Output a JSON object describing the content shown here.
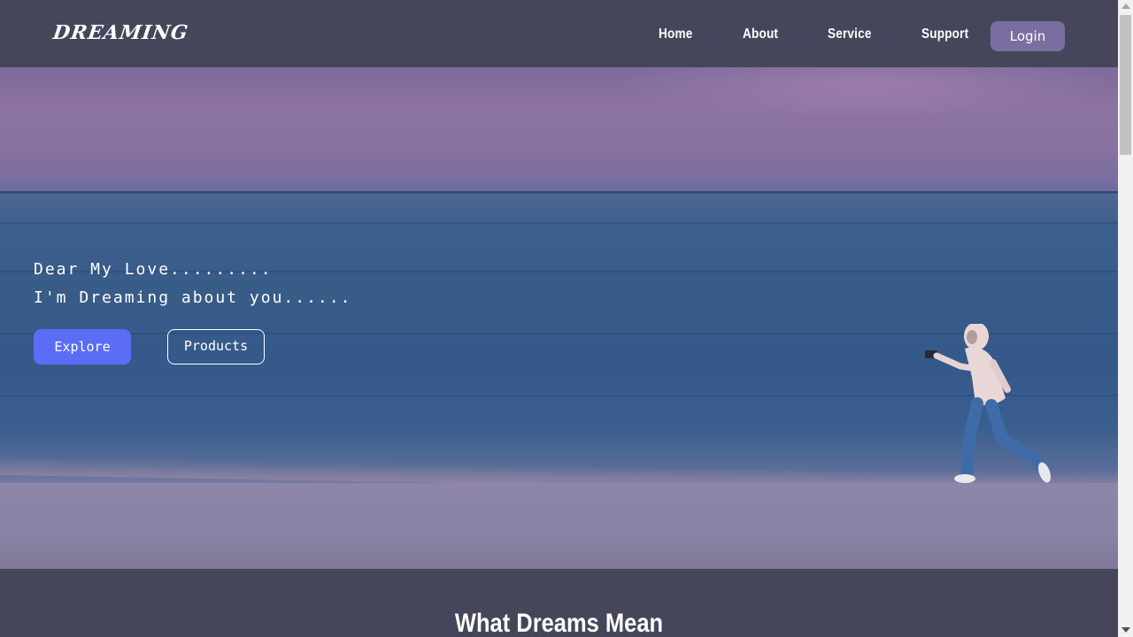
{
  "header": {
    "logo": "DREAMING",
    "nav": [
      "Home",
      "About",
      "Service",
      "Support"
    ],
    "login_label": "Login"
  },
  "hero": {
    "line1": "Dear My Love.........",
    "line2": "I'm Dreaming about you......",
    "explore_label": "Explore",
    "products_label": "Products"
  },
  "section": {
    "title": "What Dreams Mean"
  },
  "colors": {
    "background": "#454659",
    "accent": "#5b6cf5",
    "login_bg": "#7a6ea0"
  }
}
